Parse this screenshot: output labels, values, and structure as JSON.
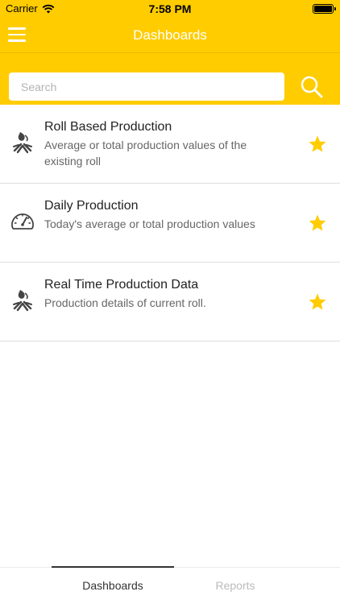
{
  "status_bar": {
    "carrier": "Carrier",
    "time": "7:58 PM"
  },
  "nav": {
    "title": "Dashboards"
  },
  "search": {
    "placeholder": "Search"
  },
  "items": [
    {
      "title": "Roll Based Production",
      "description": "Average or total production values of the existing roll",
      "icon": "roll-icon",
      "favorite": true
    },
    {
      "title": "Daily Production",
      "description": "Today's average or total production values",
      "icon": "gauge-icon",
      "favorite": true
    },
    {
      "title": "Real Time Production Data",
      "description": "Production details of current roll.",
      "icon": "roll-icon",
      "favorite": true
    }
  ],
  "tabs": [
    {
      "label": "Dashboards",
      "active": true
    },
    {
      "label": "Reports",
      "active": false
    }
  ],
  "colors": {
    "accent": "#ffcc00",
    "star": "#ffcc00"
  }
}
